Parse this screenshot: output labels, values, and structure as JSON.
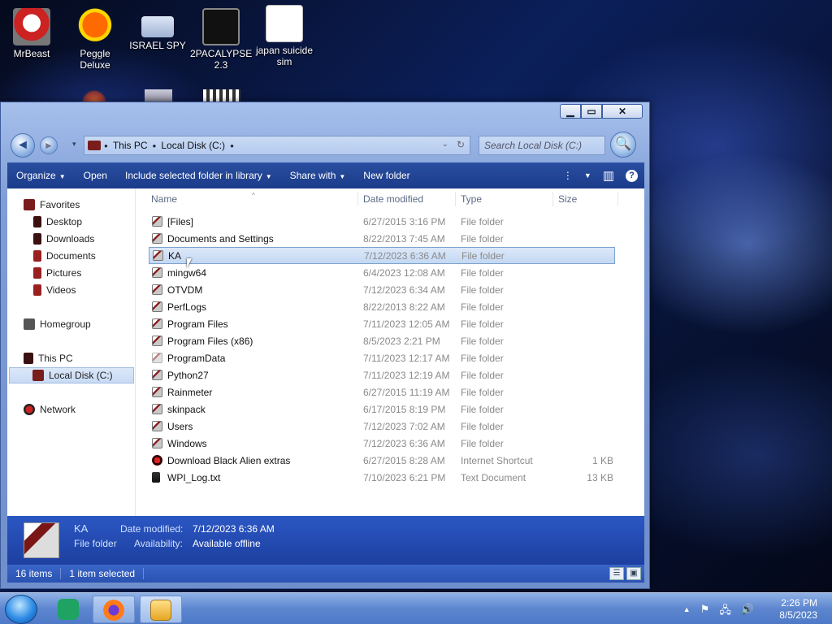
{
  "desktop": {
    "icons": [
      {
        "label": "MrBeast",
        "icon": "mrbeast-app-icon"
      },
      {
        "label": "Peggle Deluxe",
        "icon": "peggle-icon"
      },
      {
        "label": "ISRAEL SPY",
        "icon": "israel-spy-icon"
      },
      {
        "label": "2PACALYPSE 2.3",
        "icon": "console-app-icon"
      },
      {
        "label": "japan suicide sim",
        "icon": "japan-sim-icon"
      }
    ]
  },
  "window": {
    "caption": {
      "minimize": "▁",
      "maximize": "▭",
      "close": "✕"
    },
    "nav": {
      "back": "◄",
      "forward": "►",
      "recent_dropdown": "▾"
    },
    "address": {
      "segments": [
        "This PC",
        "Local Disk (C:)"
      ],
      "separator": "●",
      "dropdown": "⌄",
      "refresh": "↻"
    },
    "search": {
      "placeholder": "Search Local Disk (C:)",
      "button": "🔍"
    },
    "toolbar": {
      "organize": "Organize",
      "open": "Open",
      "include": "Include selected folder in library",
      "share": "Share with",
      "new_folder": "New folder",
      "arrow": "▼",
      "more_options": "⋮",
      "views_dropdown": "▼",
      "preview_pane": "▥",
      "help": "?"
    },
    "nav_pane": {
      "favorites": "Favorites",
      "desktop": "Desktop",
      "downloads": "Downloads",
      "documents": "Documents",
      "pictures": "Pictures",
      "videos": "Videos",
      "homegroup": "Homegroup",
      "this_pc": "This PC",
      "local_disk": "Local Disk (C:)",
      "network": "Network"
    },
    "columns": {
      "name": "Name",
      "date": "Date modified",
      "type": "Type",
      "size": "Size",
      "sort": "^"
    },
    "files": [
      {
        "name": "[Files]",
        "date": "6/27/2015 3:16 PM",
        "type": "File folder",
        "size": "",
        "kind": "folder"
      },
      {
        "name": "Documents and Settings",
        "date": "8/22/2013 7:45 AM",
        "type": "File folder",
        "size": "",
        "kind": "folder"
      },
      {
        "name": "KA",
        "date": "7/12/2023 6:36 AM",
        "type": "File folder",
        "size": "",
        "kind": "folder",
        "selected": true
      },
      {
        "name": "mingw64",
        "date": "6/4/2023 12:08 AM",
        "type": "File folder",
        "size": "",
        "kind": "folder"
      },
      {
        "name": "OTVDM",
        "date": "7/12/2023 6:34 AM",
        "type": "File folder",
        "size": "",
        "kind": "folder"
      },
      {
        "name": "PerfLogs",
        "date": "8/22/2013 8:22 AM",
        "type": "File folder",
        "size": "",
        "kind": "folder"
      },
      {
        "name": "Program Files",
        "date": "7/11/2023 12:05 AM",
        "type": "File folder",
        "size": "",
        "kind": "folder"
      },
      {
        "name": "Program Files (x86)",
        "date": "8/5/2023 2:21 PM",
        "type": "File folder",
        "size": "",
        "kind": "folder"
      },
      {
        "name": "ProgramData",
        "date": "7/11/2023 12:17 AM",
        "type": "File folder",
        "size": "",
        "kind": "folder-light"
      },
      {
        "name": "Python27",
        "date": "7/11/2023 12:19 AM",
        "type": "File folder",
        "size": "",
        "kind": "folder"
      },
      {
        "name": "Rainmeter",
        "date": "6/27/2015 11:19 AM",
        "type": "File folder",
        "size": "",
        "kind": "folder"
      },
      {
        "name": "skinpack",
        "date": "6/17/2015 8:19 PM",
        "type": "File folder",
        "size": "",
        "kind": "folder"
      },
      {
        "name": "Users",
        "date": "7/12/2023 7:02 AM",
        "type": "File folder",
        "size": "",
        "kind": "folder"
      },
      {
        "name": "Windows",
        "date": "7/12/2023 6:36 AM",
        "type": "File folder",
        "size": "",
        "kind": "folder"
      },
      {
        "name": "Download Black Alien extras",
        "date": "6/27/2015 8:28 AM",
        "type": "Internet Shortcut",
        "size": "1 KB",
        "kind": "shortcut"
      },
      {
        "name": "WPI_Log.txt",
        "date": "7/10/2023 6:21 PM",
        "type": "Text Document",
        "size": "13 KB",
        "kind": "txt"
      }
    ],
    "details": {
      "name": "KA",
      "type": "File folder",
      "date_label": "Date modified:",
      "date_value": "7/12/2023 6:36 AM",
      "avail_label": "Availability:",
      "avail_value": "Available offline"
    },
    "status": {
      "items": "16 items",
      "selected": "1 item selected"
    }
  },
  "taskbar": {
    "clock_time": "2:26 PM",
    "clock_date": "8/5/2023",
    "tray": {
      "chevron": "▲",
      "flag": "⚑",
      "network": "🖧",
      "volume": "🔊"
    }
  }
}
